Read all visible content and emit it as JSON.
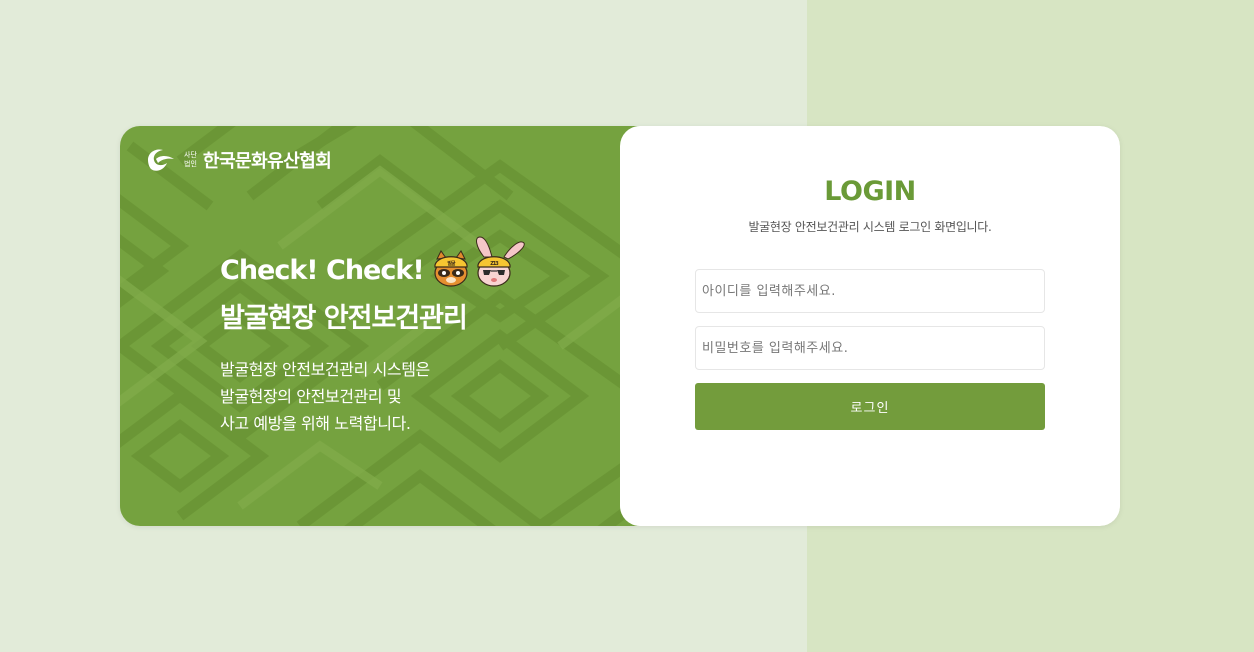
{
  "org": {
    "small_top": "사단",
    "small_bottom": "법인",
    "name": "한국문화유산협회"
  },
  "hero": {
    "line1": "Check! Check!",
    "line2": "발굴현장 안전보건관리",
    "mascot_left_badge": "발굴",
    "mascot_right_badge": "Z13"
  },
  "description": [
    "발굴현장 안전보건관리 시스템은",
    "발굴현장의 안전보건관리 및",
    "사고 예방을 위해 노력합니다."
  ],
  "login": {
    "title": "LOGIN",
    "subtitle": "발굴현장 안전보건관리 시스템 로그인 화면입니다.",
    "id_placeholder": "아이디를 입력해주세요.",
    "pw_placeholder": "비밀번호를 입력해주세요.",
    "button_label": "로그인"
  },
  "colors": {
    "page_bg": "#e2ebd9",
    "page_bg_right": "#d7e5c3",
    "panel_green": "#75a23f",
    "accent_green": "#6a9a37",
    "button_green": "#739c3c"
  }
}
